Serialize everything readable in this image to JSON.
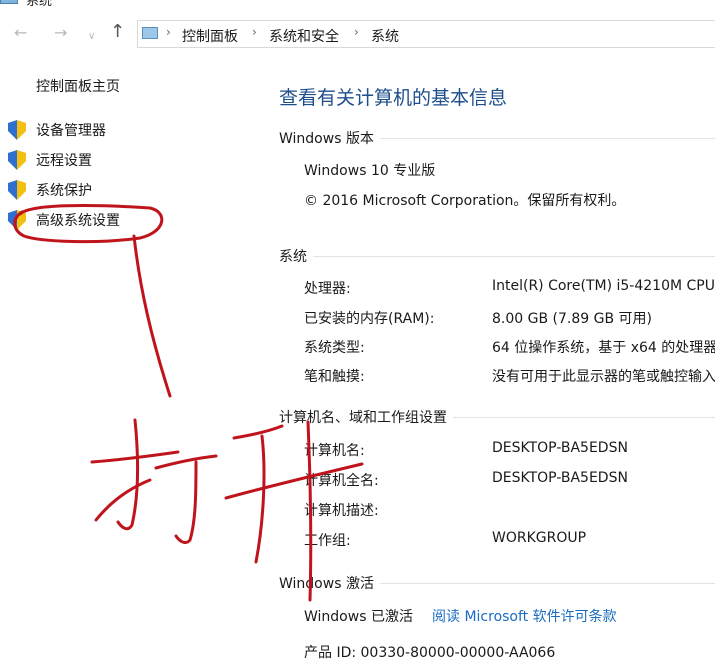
{
  "window": {
    "title": "系统"
  },
  "address": {
    "items": [
      "控制面板",
      "系统和安全",
      "系统"
    ]
  },
  "sidebar": {
    "home": "控制面板主页",
    "items": [
      {
        "label": "设备管理器"
      },
      {
        "label": "远程设置"
      },
      {
        "label": "系统保护"
      },
      {
        "label": "高级系统设置"
      }
    ]
  },
  "main": {
    "title": "查看有关计算机的基本信息",
    "edition": {
      "header": "Windows 版本",
      "name": "Windows 10 专业版",
      "copyright": "© 2016 Microsoft Corporation。保留所有权利。"
    },
    "system": {
      "header": "系统",
      "rows": [
        {
          "label": "处理器:",
          "value": "Intel(R) Core(TM) i5-4210M CPU"
        },
        {
          "label": "已安装的内存(RAM):",
          "value": "8.00 GB (7.89 GB 可用)"
        },
        {
          "label": "系统类型:",
          "value": "64 位操作系统，基于 x64 的处理器"
        },
        {
          "label": "笔和触摸:",
          "value": "没有可用于此显示器的笔或触控输入"
        }
      ]
    },
    "computer": {
      "header": "计算机名、域和工作组设置",
      "rows": [
        {
          "label": "计算机名:",
          "value": "DESKTOP-BA5EDSN"
        },
        {
          "label": "计算机全名:",
          "value": "DESKTOP-BA5EDSN"
        },
        {
          "label": "计算机描述:",
          "value": ""
        },
        {
          "label": "工作组:",
          "value": "WORKGROUP"
        }
      ]
    },
    "activation": {
      "header": "Windows 激活",
      "status": "Windows 已激活",
      "link": "阅读 Microsoft 软件许可条款",
      "product_id": "产品 ID: 00330-80000-00000-AA066"
    }
  },
  "annotation": {
    "text": "打开",
    "color": "#c0141c"
  }
}
